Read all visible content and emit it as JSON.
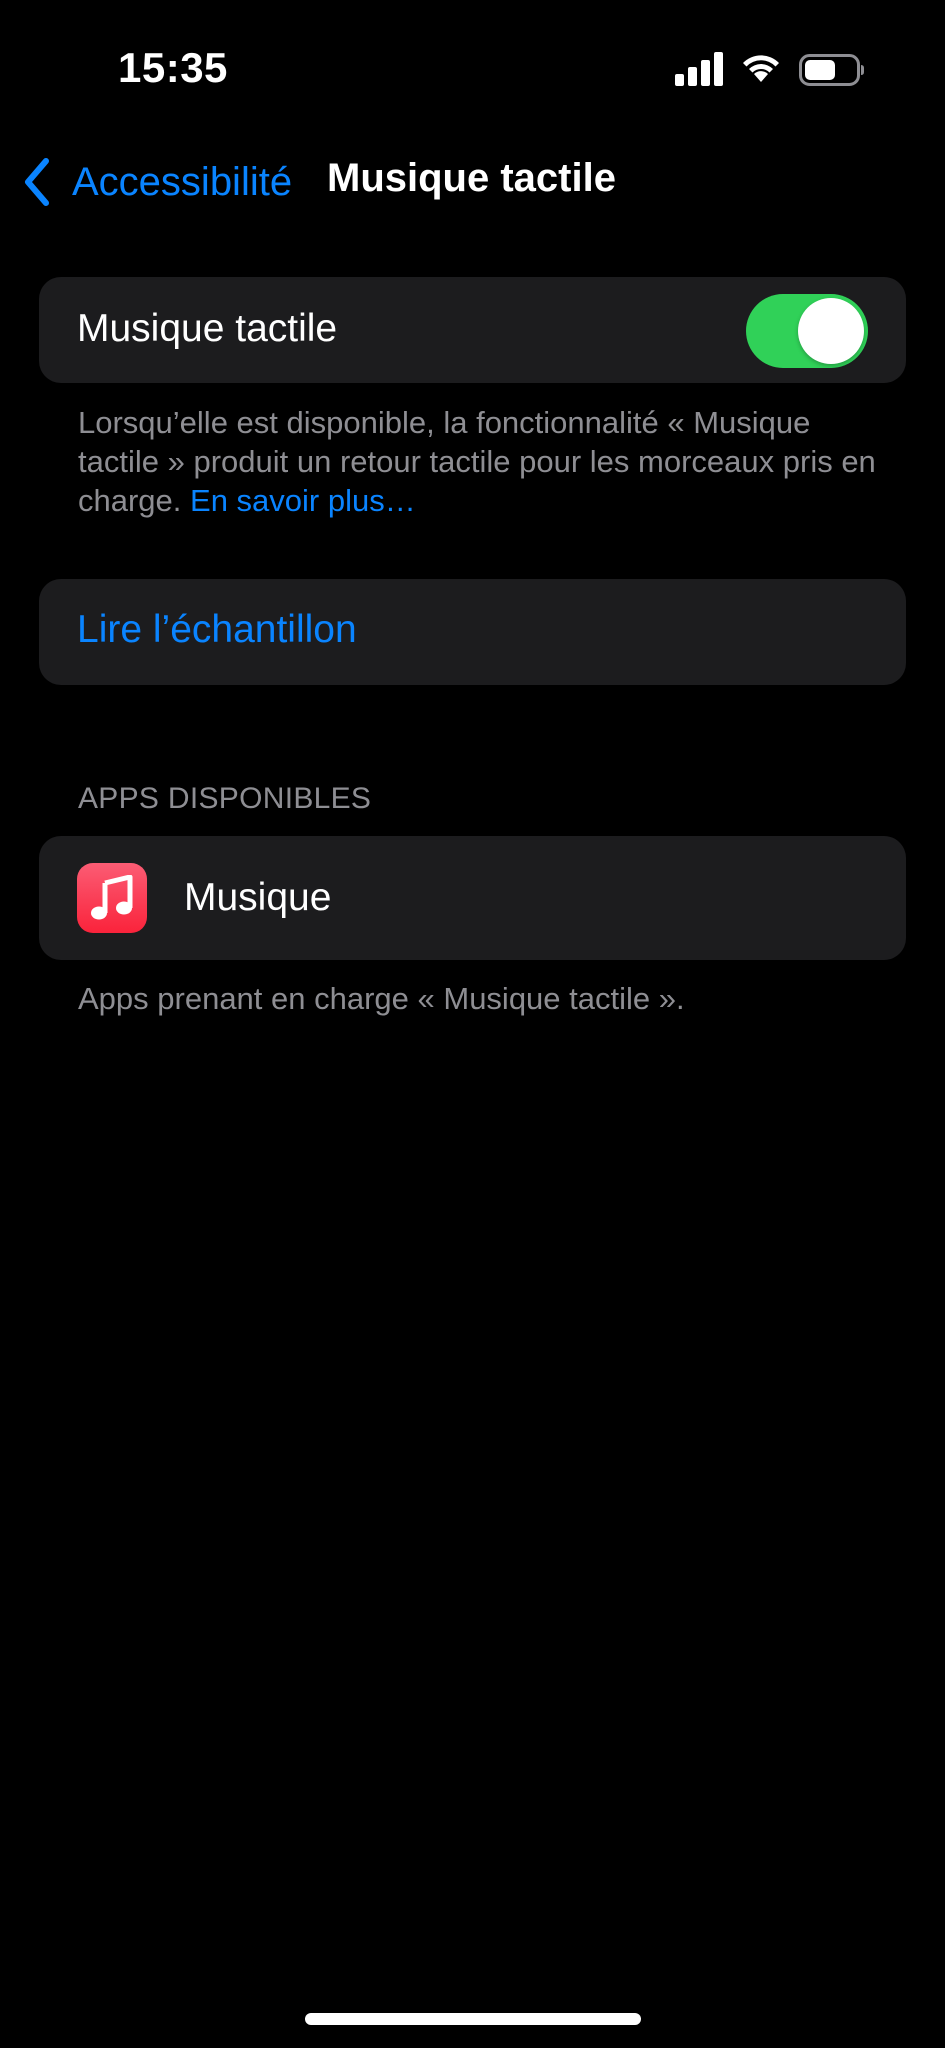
{
  "status_bar": {
    "time": "15:35",
    "icons": [
      "cellular-signal-icon",
      "wifi-icon",
      "battery-icon"
    ]
  },
  "nav": {
    "back_label": "Accessibilité",
    "title": "Musique tactile"
  },
  "toggle_cell": {
    "label": "Musique tactile",
    "enabled": true
  },
  "toggle_footer": {
    "text": "Lorsqu’elle est disponible, la fonctionnalité « Musique tactile » produit un retour tactile pour les morceaux pris en charge.",
    "link": "En savoir plus…"
  },
  "play_sample": {
    "label": "Lire l’échantillon"
  },
  "apps_section": {
    "header": "APPS DISPONIBLES",
    "items": [
      {
        "label": "Musique",
        "icon": "music-note-icon"
      }
    ],
    "footer": "Apps prenant en charge « Musique tactile »."
  },
  "colors": {
    "accent": "#0a84ff",
    "toggle_on": "#30d158",
    "cell_background": "#1c1c1e",
    "secondary_text": "#8e8e93",
    "music_app_icon": "#fa233b"
  }
}
